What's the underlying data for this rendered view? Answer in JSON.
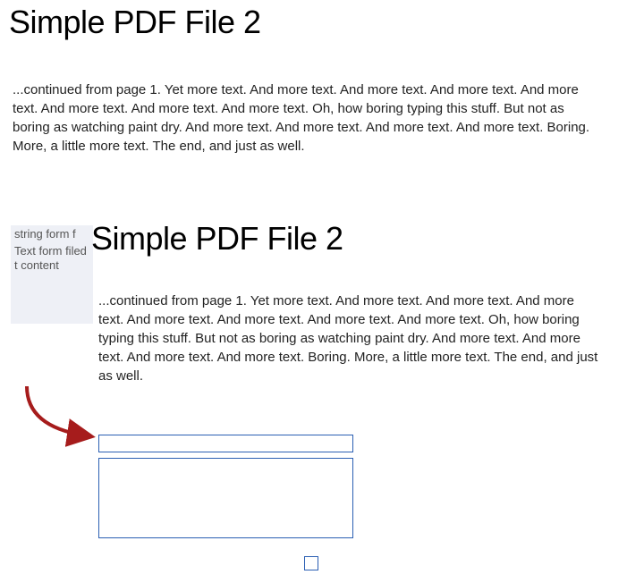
{
  "doc": {
    "title": "Simple PDF File 2",
    "body": "...continued from page 1. Yet more text. And more text. And more text. And more text. And more text. And more text. And more text. And more text. Oh, how boring typing this stuff. But not as boring as watching paint dry. And more text. And more text. And more text. And more text. Boring.  More, a little more text. The end, and just as well."
  },
  "overlay": {
    "title": "Simple PDF File 2",
    "body": "...continued from page 1. Yet more text. And more text. And more text. And more text. And more text. And more text. And more text. And more text. Oh, how boring typing this stuff. But not as boring as watching paint dry. And more text. And more text. And more text. And more text. Boring.  More, a little more text. The end, and just as well."
  },
  "form_preview": {
    "label": "string form f",
    "content": "Text form filed t content"
  },
  "fields": {
    "single_value": "",
    "multi_value": "",
    "checkbox_checked": false
  },
  "colors": {
    "field_border": "#2b5fb3",
    "arrow": "#a61c1c",
    "preview_bg": "#eef0f6"
  }
}
